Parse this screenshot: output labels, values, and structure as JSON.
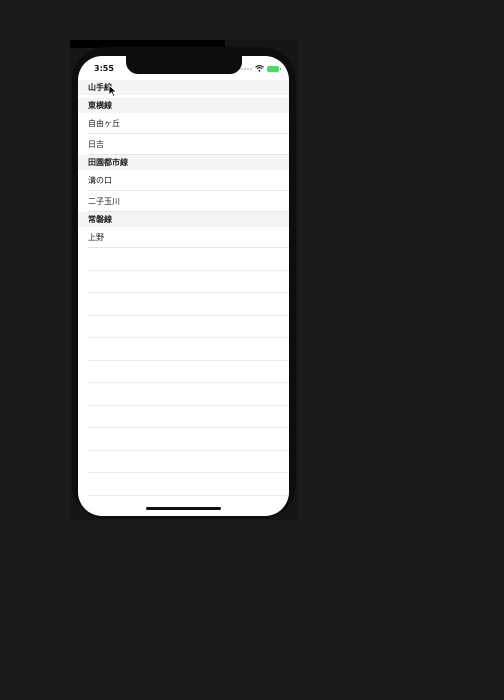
{
  "status_bar": {
    "time": "3:55",
    "battery_color": "#4cd964"
  },
  "sections": [
    {
      "header": "山手線",
      "rows": []
    },
    {
      "header": "東横線",
      "rows": [
        "自由ヶ丘",
        "日吉"
      ]
    },
    {
      "header": "田園都市線",
      "rows": [
        "溝の口",
        "二子玉川"
      ]
    },
    {
      "header": "常磐線",
      "rows": [
        "上野"
      ]
    }
  ]
}
